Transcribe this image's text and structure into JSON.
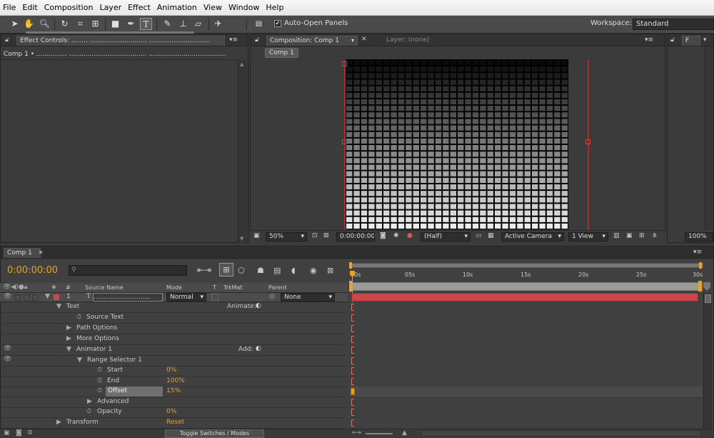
{
  "menu": [
    "File",
    "Edit",
    "Composition",
    "Layer",
    "Effect",
    "Animation",
    "View",
    "Window",
    "Help"
  ],
  "toolbar": {
    "auto_open_label": "Auto-Open Panels",
    "auto_open_checked": "✔",
    "workspace_label": "Workspace:",
    "workspace_value": "Standard"
  },
  "effect_panel": {
    "tab": "Effect Controls: ........ ............................ ..............................",
    "layer": "Comp 1 • ............... ...................................... ......................................"
  },
  "viewer": {
    "tab": "Composition: Comp 1",
    "layer_tab": "Layer: (none)",
    "comp_button": "Comp 1",
    "zoom": "50%",
    "timecode": "0:00:00:00",
    "resolution": "(Half)",
    "camera": "Active Camera",
    "views": "1 View"
  },
  "right_panel": {
    "zoom": "100%"
  },
  "timeline": {
    "tab": "Comp 1",
    "current_time": "0:00:00:00",
    "columns": {
      "hash": "#",
      "source_name": "Source Name",
      "mode": "Mode",
      "t": "T",
      "trkmat": "TrkMat",
      "parent": "Parent"
    },
    "layer": {
      "number": "1",
      "icon": "T",
      "name": "............................",
      "mode": "Normal",
      "parent": "None"
    },
    "rows": [
      {
        "label": "Text",
        "extra": "Animate:"
      },
      {
        "label": "Source Text"
      },
      {
        "label": "Path Options"
      },
      {
        "label": "More Options"
      },
      {
        "label": "Animator 1",
        "extra": "Add:"
      },
      {
        "label": "Range Selector 1"
      },
      {
        "label": "Start",
        "value": "0%"
      },
      {
        "label": "End",
        "value": "100%"
      },
      {
        "label": "Offset",
        "value": "15%"
      },
      {
        "label": "Advanced"
      },
      {
        "label": "Opacity",
        "value": "0%"
      },
      {
        "label": "Transform",
        "value": "Reset"
      }
    ],
    "ruler": [
      "00s",
      "05s",
      "10s",
      "15s",
      "20s",
      "25s",
      "30s"
    ],
    "toggle_label": "Toggle Switches / Modes"
  },
  "colors": {
    "accent": "#e6a22a",
    "layer_bar": "#c8474c",
    "workarea": "#9a9a9a"
  }
}
